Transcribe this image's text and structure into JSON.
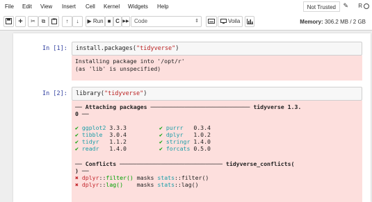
{
  "menu": {
    "items": [
      "File",
      "Edit",
      "View",
      "Insert",
      "Cell",
      "Kernel",
      "Widgets",
      "Help"
    ],
    "trust_label": "Not Trusted",
    "kernel_label": "R"
  },
  "toolbar": {
    "save_icon": "💾",
    "add_icon": "+",
    "cut_icon": "✂",
    "copy_icon": "⧉",
    "paste_icon": "📋",
    "up_icon": "↑",
    "down_icon": "↓",
    "run_label": "▶ Run",
    "stop_icon": "■",
    "restart_icon": "C",
    "fastforward_icon": "▶▶",
    "cell_type": "Code",
    "voila_label": "Voila",
    "memory_label": "Memory:",
    "memory_value": "306.2 MB / 2 GB"
  },
  "cells": [
    {
      "prompt": "In [1]:",
      "code_fn": "install.packages(",
      "code_str": "\"tidyverse\"",
      "code_end": ")",
      "output": [
        "Installing package into '/opt/r'",
        "(as 'lib' is unspecified)"
      ]
    },
    {
      "prompt": "In [2]:",
      "code_fn": "library(",
      "code_str": "\"tidyverse\"",
      "code_end": ")",
      "attach_header": "── Attaching packages ───────────────────────────── tidyverse 1.3.",
      "attach_header_2": "0 ──",
      "packages": [
        [
          "ggplot2",
          "3.3.3",
          "purrr",
          "0.3.4"
        ],
        [
          "tibble",
          "3.0.4",
          "dplyr",
          "1.0.2"
        ],
        [
          "tidyr",
          "1.1.2",
          "stringr",
          "1.4.0"
        ],
        [
          "readr",
          "1.4.0",
          "forcats",
          "0.5.0"
        ]
      ],
      "check_mark": "✔",
      "conflicts_header": "── Conflicts ────────────────────────────── tidyverse_conflicts(",
      "conflicts_header_2": ") ──",
      "conflicts": [
        {
          "pkg": "dplyr",
          "fn": "filter()",
          "masks": "masks",
          "pkg2": "stats",
          "fn2": "filter()"
        },
        {
          "pkg": "dplyr",
          "fn": "lag()",
          "masks": "masks",
          "pkg2": "stats",
          "fn2": "lag()"
        }
      ],
      "cross_mark": "✖",
      "sep": "::"
    }
  ]
}
